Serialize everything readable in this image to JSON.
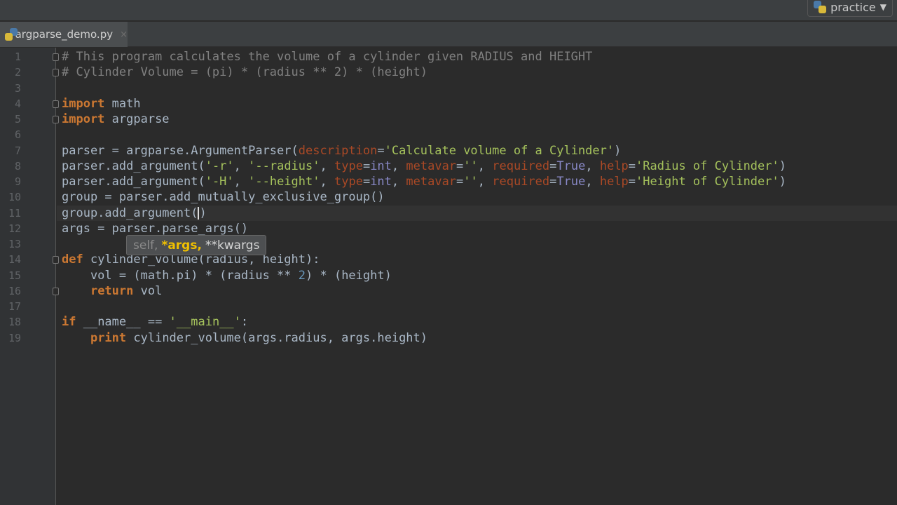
{
  "toolbar": {
    "project": "practice",
    "project_icon": "python-icon"
  },
  "tabs": [
    {
      "label": "argparse_demo.py",
      "close": "×",
      "icon": "python-file-icon"
    }
  ],
  "editor": {
    "lines": [
      [
        [
          "# This program calculates the volume of a cylinder given RADIUS and HEIGHT",
          "c"
        ]
      ],
      [
        [
          "# Cylinder Volume = (pi) * (radius ** 2) * (height)",
          "c"
        ]
      ],
      [],
      [
        [
          "import",
          "k"
        ],
        [
          " math",
          "d"
        ]
      ],
      [
        [
          "import",
          "k"
        ],
        [
          " argparse",
          "d"
        ]
      ],
      [],
      [
        [
          "parser = argparse.ArgumentParser(",
          "d"
        ],
        [
          "description",
          "n"
        ],
        [
          "=",
          "d"
        ],
        [
          "'Calculate volume of a Cylinder'",
          "s"
        ],
        [
          ")",
          "d"
        ]
      ],
      [
        [
          "parser.add_argument(",
          "d"
        ],
        [
          "'-r'",
          "s"
        ],
        [
          ", ",
          "d"
        ],
        [
          "'--radius'",
          "s"
        ],
        [
          ", ",
          "d"
        ],
        [
          "type",
          "n"
        ],
        [
          "=",
          "d"
        ],
        [
          "int",
          "b"
        ],
        [
          ", ",
          "d"
        ],
        [
          "metavar",
          "n"
        ],
        [
          "=",
          "d"
        ],
        [
          "''",
          "s"
        ],
        [
          ", ",
          "d"
        ],
        [
          "required",
          "n"
        ],
        [
          "=",
          "d"
        ],
        [
          "True",
          "b"
        ],
        [
          ", ",
          "d"
        ],
        [
          "help",
          "n"
        ],
        [
          "=",
          "d"
        ],
        [
          "'Radius of Cylinder'",
          "s"
        ],
        [
          ")",
          "d"
        ]
      ],
      [
        [
          "parser.add_argument(",
          "d"
        ],
        [
          "'-H'",
          "s"
        ],
        [
          ", ",
          "d"
        ],
        [
          "'--height'",
          "s"
        ],
        [
          ", ",
          "d"
        ],
        [
          "type",
          "n"
        ],
        [
          "=",
          "d"
        ],
        [
          "int",
          "b"
        ],
        [
          ", ",
          "d"
        ],
        [
          "metavar",
          "n"
        ],
        [
          "=",
          "d"
        ],
        [
          "''",
          "s"
        ],
        [
          ", ",
          "d"
        ],
        [
          "required",
          "n"
        ],
        [
          "=",
          "d"
        ],
        [
          "True",
          "b"
        ],
        [
          ", ",
          "d"
        ],
        [
          "help",
          "n"
        ],
        [
          "=",
          "d"
        ],
        [
          "'Height of Cylinder'",
          "s"
        ],
        [
          ")",
          "d"
        ]
      ],
      [
        [
          "group = parser.add_mutually_exclusive_group()",
          "d"
        ]
      ],
      [
        [
          "group.add_argument(",
          "d"
        ],
        [
          "|",
          "caret"
        ],
        [
          ")",
          "d"
        ]
      ],
      [
        [
          "args = parser.parse_args()",
          "d"
        ]
      ],
      [],
      [
        [
          "def",
          "k"
        ],
        [
          " cylinder_volume(radius, height):",
          "d"
        ]
      ],
      [
        [
          "    vol = (math.pi) * (radius ** ",
          "d"
        ],
        [
          "2",
          "num"
        ],
        [
          ") * (height)",
          "d"
        ]
      ],
      [
        [
          "    ",
          "d"
        ],
        [
          "return",
          "k"
        ],
        [
          " vol",
          "d"
        ]
      ],
      [],
      [
        [
          "if",
          "k"
        ],
        [
          " __name__ == ",
          "d"
        ],
        [
          "'__main__'",
          "s"
        ],
        [
          ":",
          "d"
        ]
      ],
      [
        [
          "    ",
          "d"
        ],
        [
          "print",
          "k"
        ],
        [
          " cylinder_volume(args.radius, args.height)",
          "d"
        ]
      ]
    ]
  },
  "tooltip": {
    "self": "self,",
    "args": "*args,",
    "kwargs": "**kwargs"
  }
}
